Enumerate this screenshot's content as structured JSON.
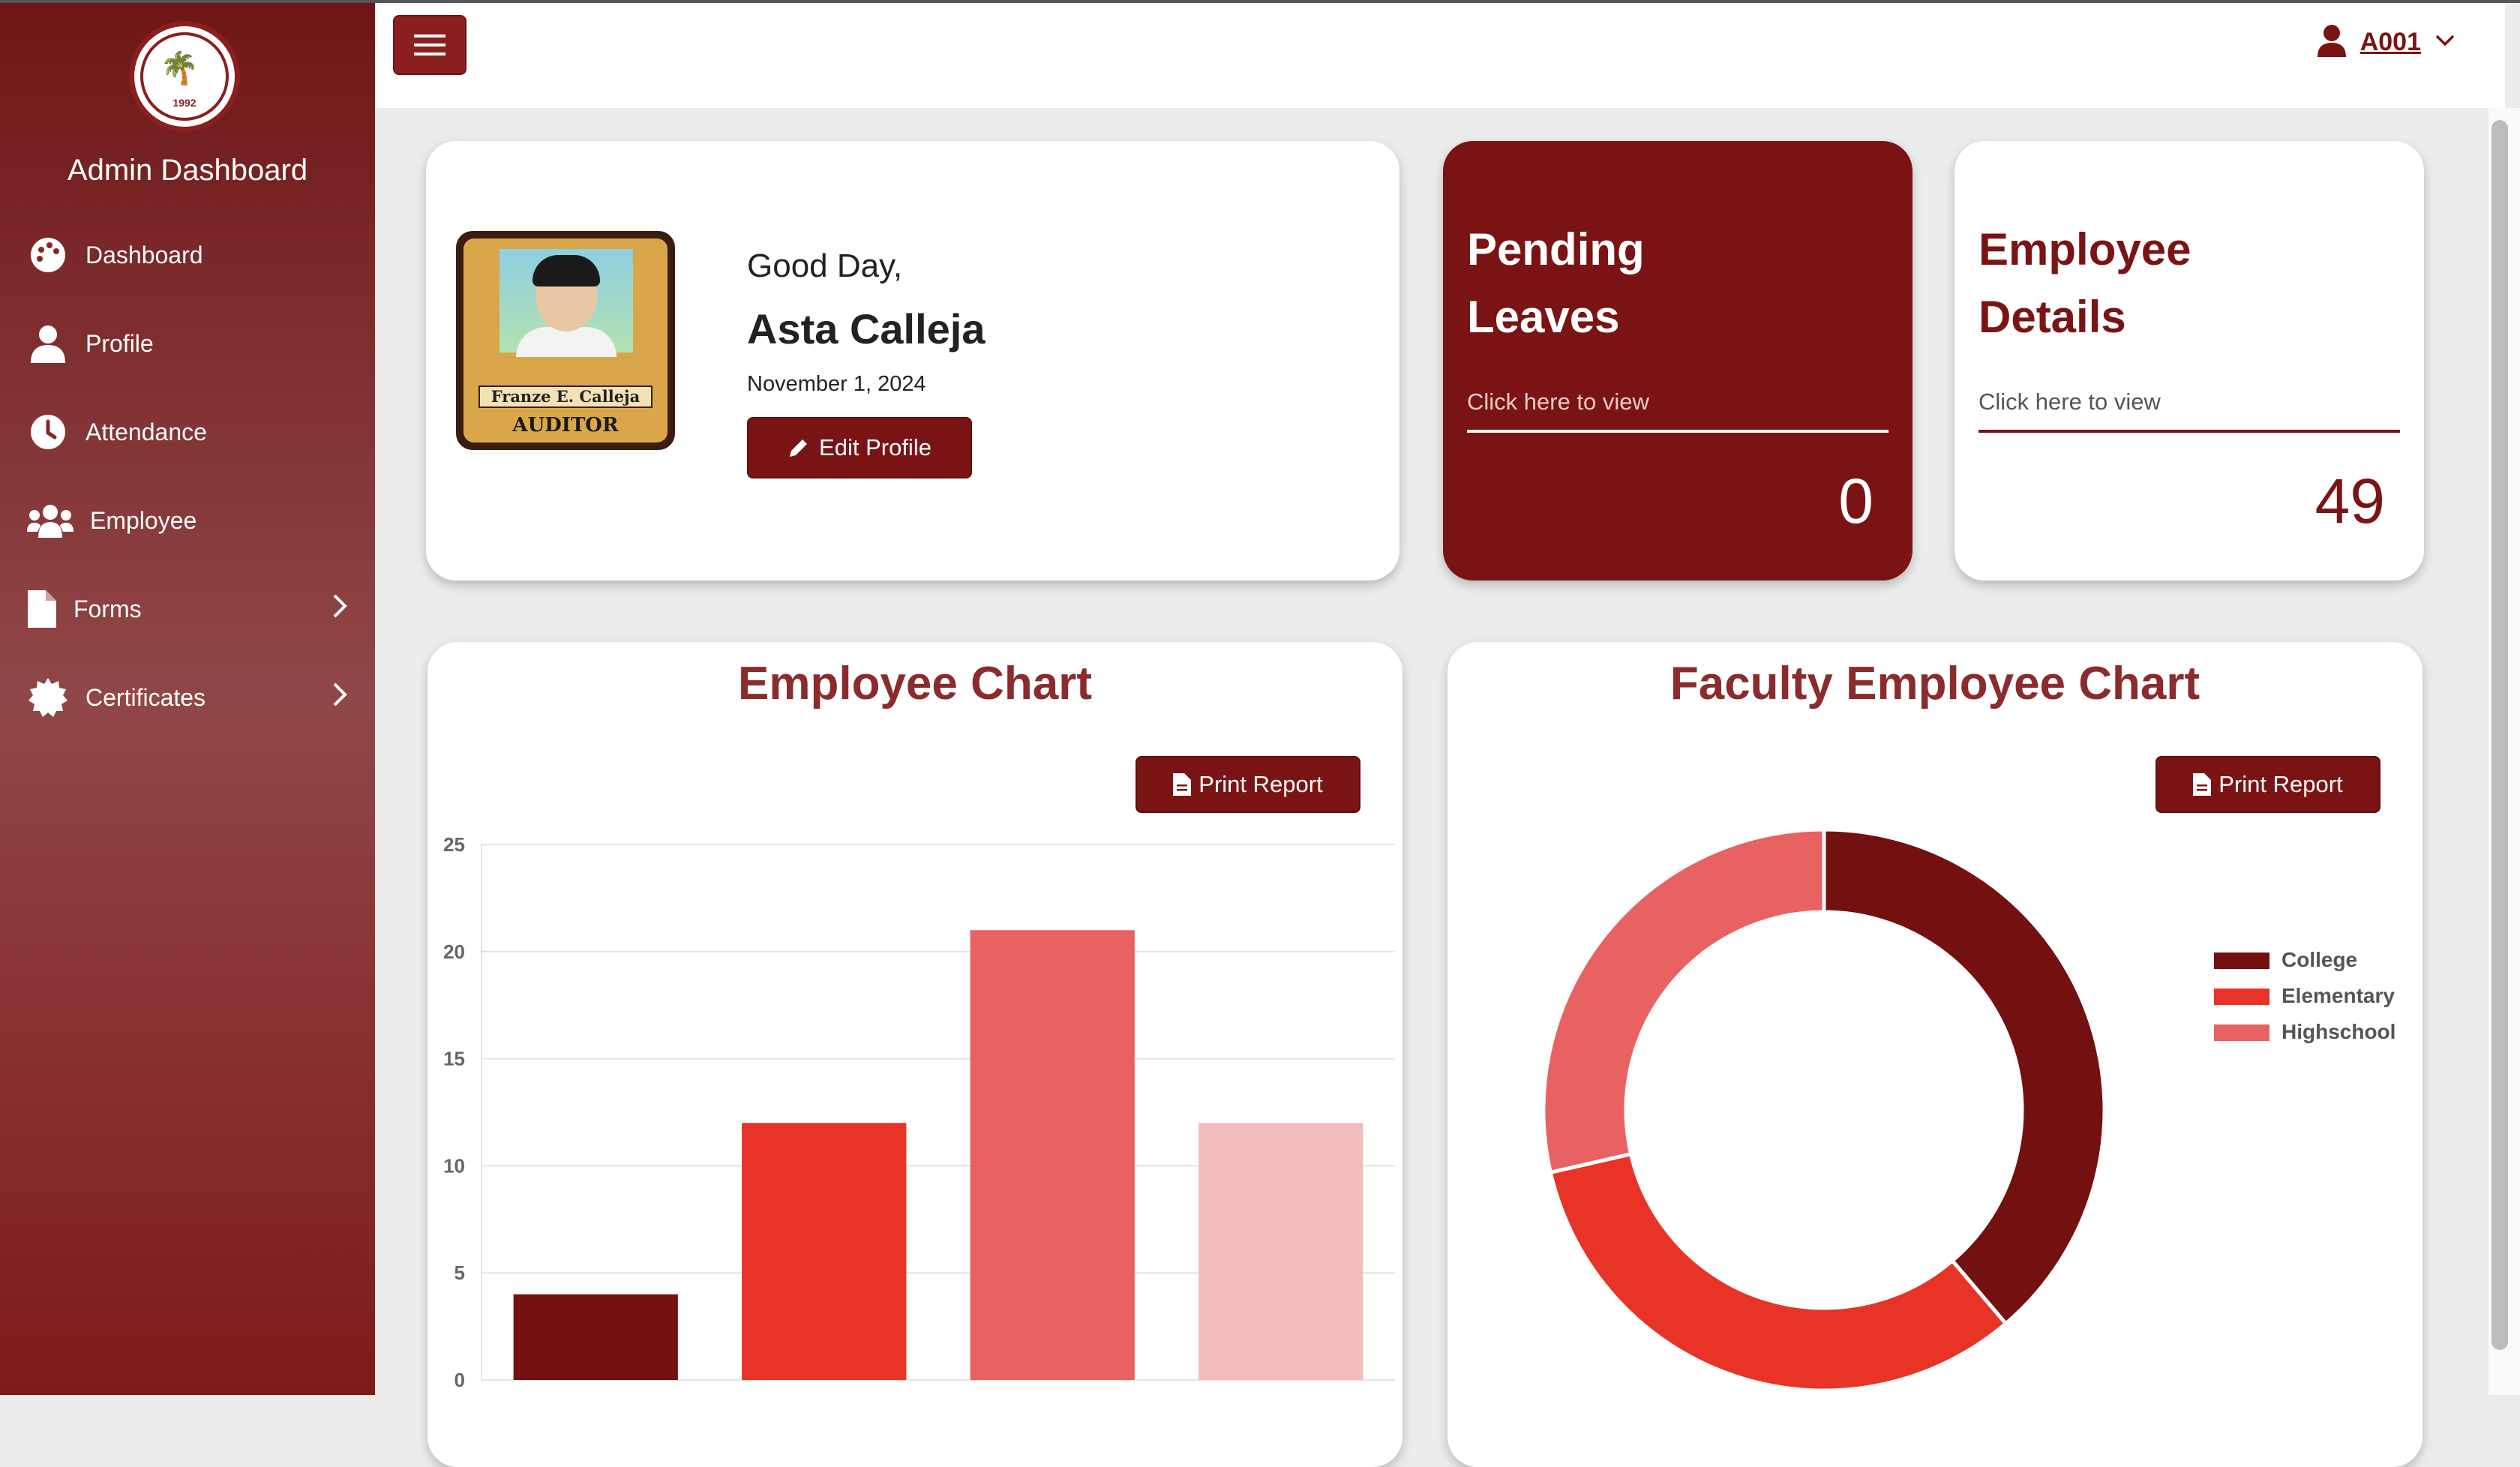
{
  "sidebar": {
    "title": "Admin Dashboard",
    "logo_year": "1992",
    "items": [
      {
        "label": "Dashboard",
        "icon": "palette-icon"
      },
      {
        "label": "Profile",
        "icon": "user-icon"
      },
      {
        "label": "Attendance",
        "icon": "clock-icon"
      },
      {
        "label": "Employee",
        "icon": "users-icon"
      },
      {
        "label": "Forms",
        "icon": "file-icon",
        "has_submenu": true
      },
      {
        "label": "Certificates",
        "icon": "certificate-icon",
        "has_submenu": true
      }
    ]
  },
  "header": {
    "user_id": "A001"
  },
  "profile": {
    "greeting": "Good Day,",
    "name": "Asta Calleja",
    "date": "November 1, 2024",
    "edit_label": "Edit Profile",
    "card_name": "Franze E. Calleja",
    "card_role": "AUDITOR"
  },
  "pending_leaves": {
    "title_line1": "Pending",
    "title_line2": "Leaves",
    "link": "Click here to view",
    "value": "0"
  },
  "employee_details": {
    "title_line1": "Employee",
    "title_line2": "Details",
    "link": "Click here to view",
    "value": "49"
  },
  "colors": {
    "brand": "#7a1414",
    "college": "#731010",
    "elementary": "#e73427",
    "highschool": "#e86262",
    "bar4": "#f2bcbc"
  },
  "employee_chart": {
    "title": "Employee Chart",
    "print_label": "Print Report"
  },
  "faculty_chart": {
    "title": "Faculty Employee Chart",
    "print_label": "Print Report"
  },
  "chart_data": [
    {
      "type": "bar",
      "title": "Employee Chart",
      "categories": [
        "",
        "",
        "",
        ""
      ],
      "values": [
        4,
        12,
        21,
        12
      ],
      "colors": [
        "#731010",
        "#e73427",
        "#e86262",
        "#f2bcbc"
      ],
      "ylim": [
        0,
        25
      ],
      "yticks": [
        0,
        5,
        10,
        15,
        20,
        25
      ],
      "grid": true
    },
    {
      "type": "pie",
      "title": "Faculty Employee Chart",
      "donut": true,
      "labels": [
        "College",
        "Elementary",
        "Highschool"
      ],
      "values": [
        19,
        16,
        14
      ],
      "colors": [
        "#731010",
        "#e73427",
        "#e86262"
      ],
      "legend_position": "right"
    }
  ]
}
